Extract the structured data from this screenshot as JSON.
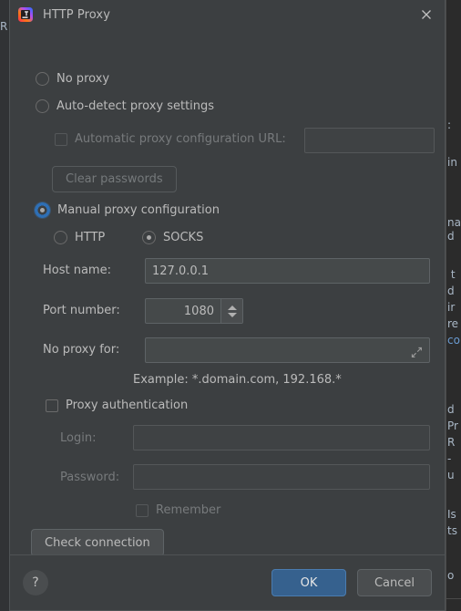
{
  "window": {
    "title": "HTTP Proxy",
    "app_icon": "intellij-idea-logo",
    "close_icon": "close-icon"
  },
  "background": {
    "left_fragment": "R",
    "right_fragments": [
      ": ",
      "in",
      "na",
      "d",
      "t",
      "d",
      "ir",
      "re",
      "co",
      "d",
      "Pro",
      "R",
      "-",
      "u",
      "Is",
      "ts",
      "o"
    ]
  },
  "proxy_mode": {
    "no_proxy": {
      "label": "No proxy",
      "selected": false
    },
    "auto_detect": {
      "label": "Auto-detect proxy settings",
      "selected": false
    },
    "manual": {
      "label": "Manual proxy configuration",
      "selected": true,
      "focused": true
    }
  },
  "auto_detect_options": {
    "pac_checkbox_label": "Automatic proxy configuration URL:",
    "pac_checked": false,
    "pac_url_value": "",
    "clear_passwords_label": "Clear passwords",
    "clear_passwords_enabled": false
  },
  "manual_options": {
    "protocol": {
      "http": {
        "label": "HTTP",
        "selected": false
      },
      "socks": {
        "label": "SOCKS",
        "selected": true
      }
    },
    "host_name": {
      "label": "Host name:",
      "value": "127.0.0.1"
    },
    "port_number": {
      "label": "Port number:",
      "value": "1080"
    },
    "no_proxy_for": {
      "label": "No proxy for:",
      "value": "",
      "expand_icon": "expand-icon"
    },
    "example_hint": "Example: *.domain.com, 192.168.*"
  },
  "authentication": {
    "checkbox_label": "Proxy authentication",
    "checked": false,
    "login": {
      "label": "Login:",
      "value": ""
    },
    "password": {
      "label": "Password:",
      "value": ""
    },
    "remember": {
      "label": "Remember",
      "checked": false
    }
  },
  "check_connection_label": "Check connection",
  "footer": {
    "help_label": "?",
    "ok_label": "OK",
    "cancel_label": "Cancel"
  },
  "colors": {
    "dialog_bg": "#3c3f41",
    "field_bg": "#45494a",
    "accent_blue": "#36618e",
    "focus_ring": "#2e6fb5",
    "text": "#bbbbbb",
    "text_disabled": "#777a7c"
  }
}
